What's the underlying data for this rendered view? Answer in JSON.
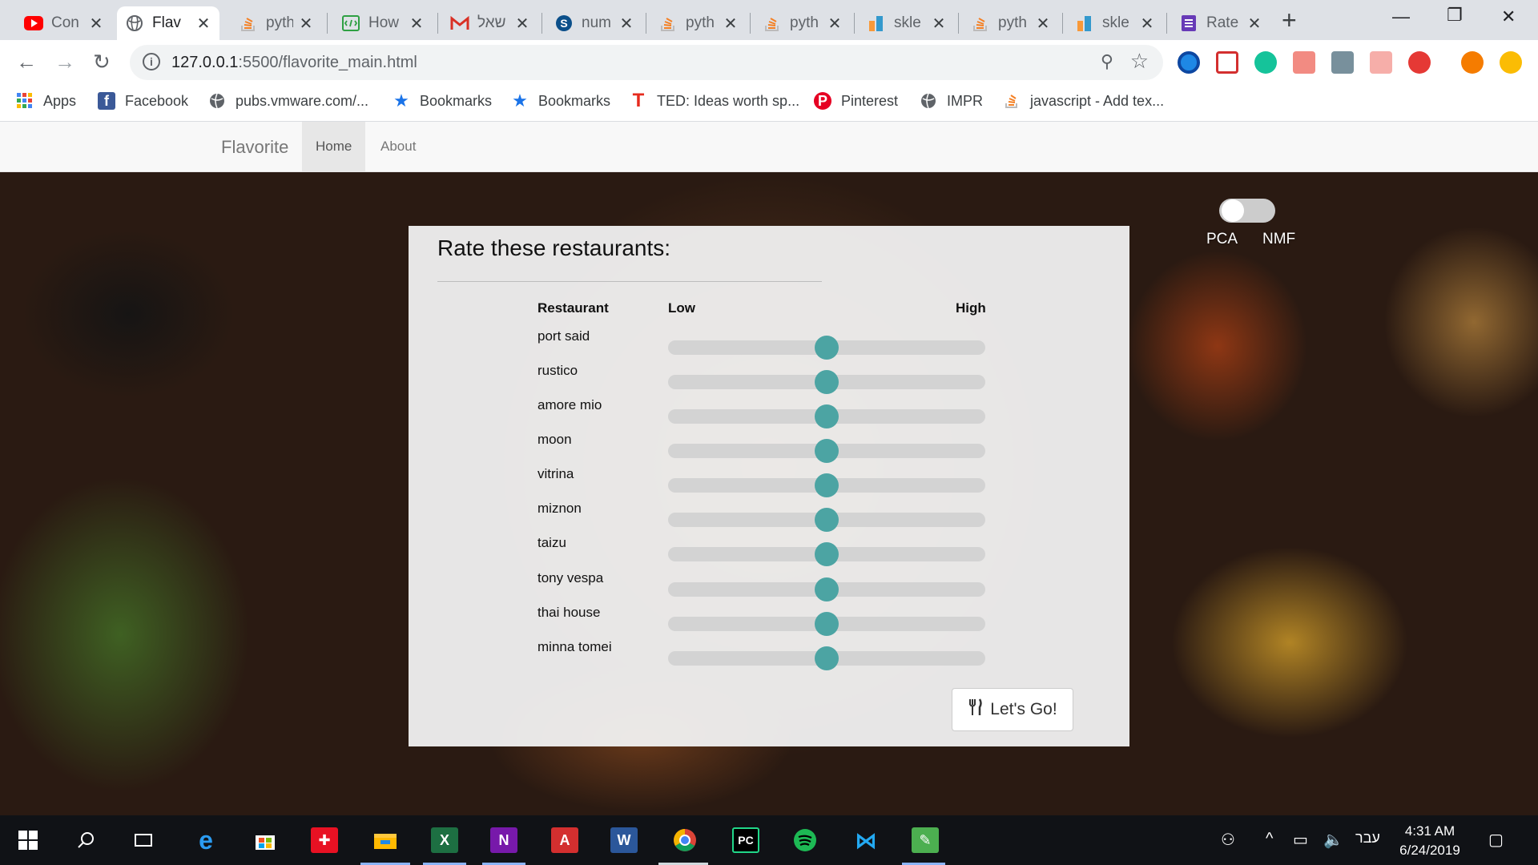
{
  "browser": {
    "tabs": [
      {
        "title": "Con",
        "icon": "youtube-icon",
        "active": false
      },
      {
        "title": "Flav",
        "icon": "globe-icon",
        "active": true
      },
      {
        "title": "pyth",
        "icon": "stackoverflow-icon",
        "active": false
      },
      {
        "title": "How",
        "icon": "codeshare-icon",
        "active": false
      },
      {
        "title": "שאל",
        "icon": "gmail-icon",
        "active": false
      },
      {
        "title": "num",
        "icon": "scipy-icon",
        "active": false
      },
      {
        "title": "pyth",
        "icon": "stackoverflow-icon",
        "active": false
      },
      {
        "title": "pyth",
        "icon": "stackoverflow-icon",
        "active": false
      },
      {
        "title": "skle",
        "icon": "sklearn-icon",
        "active": false
      },
      {
        "title": "pyth",
        "icon": "stackoverflow-icon",
        "active": false
      },
      {
        "title": "skle",
        "icon": "sklearn-icon",
        "active": false
      },
      {
        "title": "Rate",
        "icon": "forms-icon",
        "active": false
      }
    ],
    "address": {
      "host": "127.0.0.1",
      "rest": ":5500/flavorite_main.html"
    },
    "bookmarks": [
      {
        "label": "Apps",
        "icon": "apps-grid-icon"
      },
      {
        "label": "Facebook",
        "icon": "facebook-icon"
      },
      {
        "label": "pubs.vmware.com/...",
        "icon": "globe-icon"
      },
      {
        "label": "Bookmarks",
        "icon": "star-icon"
      },
      {
        "label": "Bookmarks",
        "icon": "star-icon"
      },
      {
        "label": "TED: Ideas worth sp...",
        "icon": "ted-icon"
      },
      {
        "label": "Pinterest",
        "icon": "pinterest-icon"
      },
      {
        "label": "IMPR",
        "icon": "globe-icon"
      },
      {
        "label": "javascript - Add tex...",
        "icon": "stackoverflow-icon"
      }
    ]
  },
  "site": {
    "brand": "Flavorite",
    "nav": [
      {
        "label": "Home",
        "active": true
      },
      {
        "label": "About",
        "active": false
      }
    ],
    "toggle": {
      "left_label": "PCA",
      "right_label": "NMF",
      "state": "PCA"
    }
  },
  "rating": {
    "title": "Rate these restaurants:",
    "headers": {
      "restaurant": "Restaurant",
      "low": "Low",
      "high": "High"
    },
    "slider_value_fraction": 0.5,
    "restaurants": [
      {
        "name": "port said",
        "value": 0.5
      },
      {
        "name": "rustico",
        "value": 0.5
      },
      {
        "name": "amore mio",
        "value": 0.5
      },
      {
        "name": "moon",
        "value": 0.5
      },
      {
        "name": "vitrina",
        "value": 0.5
      },
      {
        "name": "miznon",
        "value": 0.5
      },
      {
        "name": "taizu",
        "value": 0.5
      },
      {
        "name": "tony vespa",
        "value": 0.5
      },
      {
        "name": "thai house",
        "value": 0.5
      },
      {
        "name": "minna tomei",
        "value": 0.5
      }
    ],
    "button_label": "Let's Go!",
    "accent_color": "#4ca4a3"
  },
  "taskbar": {
    "language": "עבר",
    "time": "4:31 AM",
    "date": "6/24/2019"
  }
}
